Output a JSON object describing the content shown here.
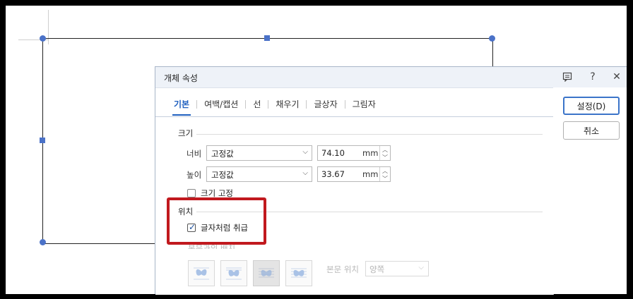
{
  "dialog": {
    "title": "개체 속성",
    "tabs": [
      "기본",
      "여백/캡션",
      "선",
      "채우기",
      "글상자",
      "그림자"
    ],
    "buttons": {
      "ok": "설정(D)",
      "cancel": "취소"
    }
  },
  "size_section": {
    "label": "크기",
    "width": {
      "label": "너비",
      "mode": "고정값",
      "value": "74.10",
      "unit": "mm"
    },
    "height": {
      "label": "높이",
      "mode": "고정값",
      "value": "33.67",
      "unit": "mm"
    },
    "fix_size": {
      "label": "크기 고정",
      "checked": false
    }
  },
  "position_section": {
    "label": "위치",
    "treat_as_char": {
      "label": "글자처럼 취급",
      "checked": true
    },
    "text_wrap_label": "본문과의 배치",
    "body_position_label": "본문 위치",
    "body_position_value": "양쪽"
  },
  "colors": {
    "accent": "#1e5fbf",
    "highlight": "#c1191e",
    "handle": "#4b72c8"
  }
}
